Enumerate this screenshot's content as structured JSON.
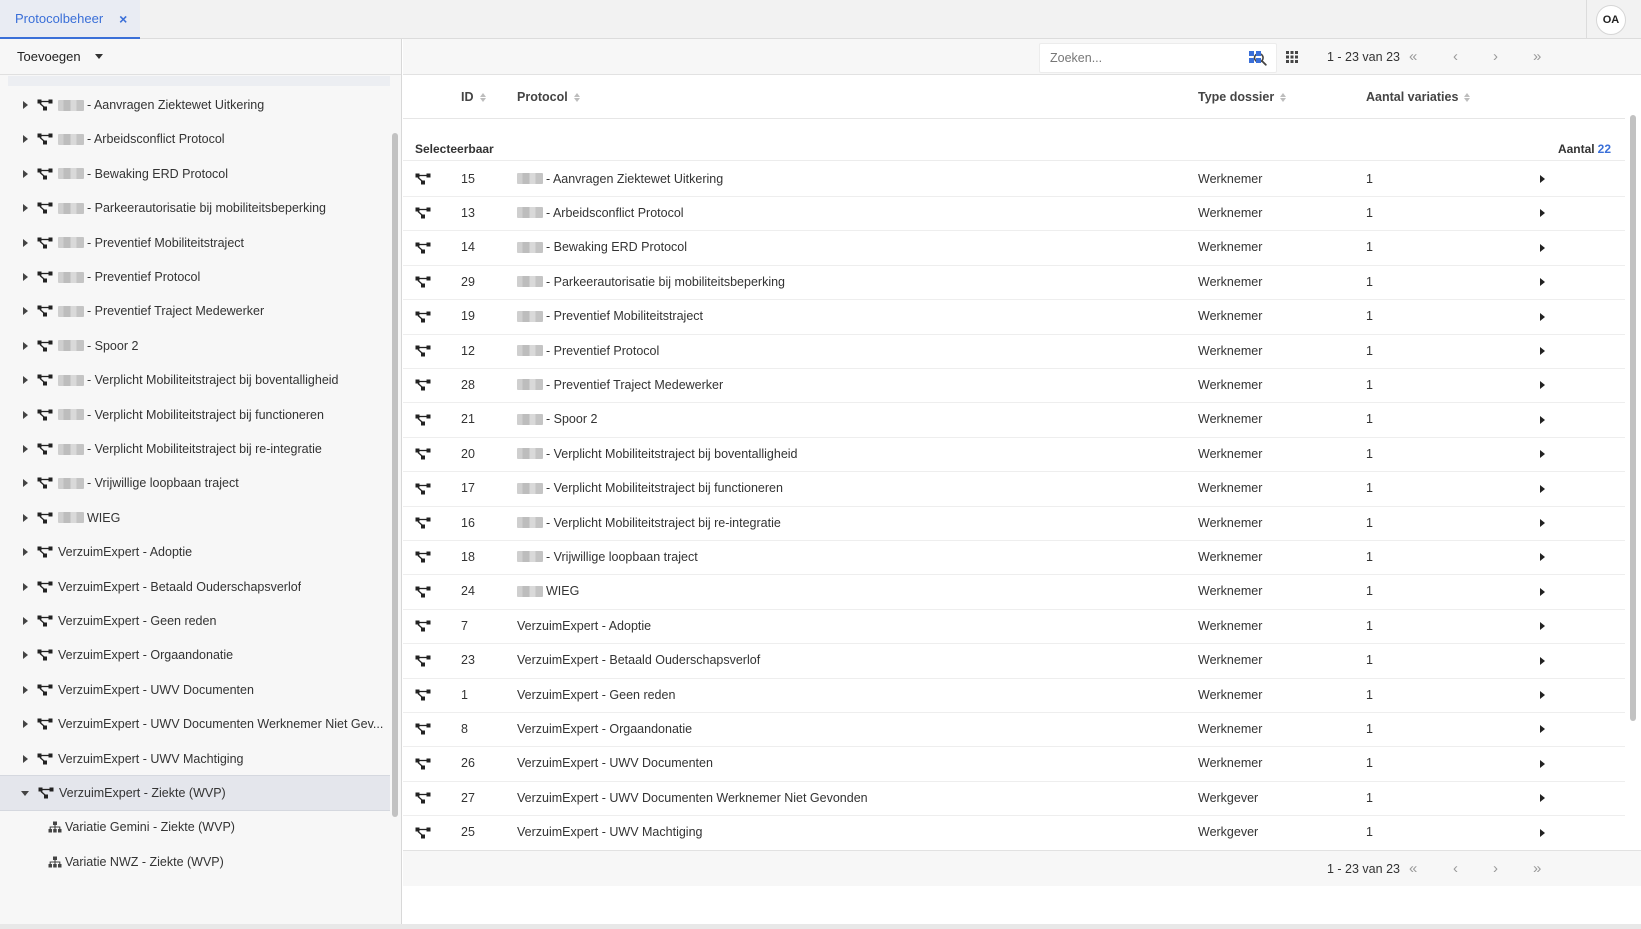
{
  "tabbar": {
    "tab_label": "Protocolbeheer",
    "close_glyph": "×",
    "avatar_initials": "OA"
  },
  "colors": {
    "accent": "#3a6fd8",
    "panel_bg": "#f7f7f7",
    "selected_row": "#e4e6ec"
  },
  "left": {
    "add_label": "Toevoegen",
    "tree": [
      {
        "label": "- Aanvragen Ziektewet Uitkering",
        "masked": true,
        "expanded": false
      },
      {
        "label": "- Arbeidsconflict Protocol",
        "masked": true,
        "expanded": false
      },
      {
        "label": "- Bewaking ERD Protocol",
        "masked": true,
        "expanded": false
      },
      {
        "label": "- Parkeerautorisatie bij mobiliteitsbeperking",
        "masked": true,
        "expanded": false
      },
      {
        "label": "- Preventief Mobiliteitstraject",
        "masked": true,
        "expanded": false
      },
      {
        "label": "- Preventief Protocol",
        "masked": true,
        "expanded": false
      },
      {
        "label": "- Preventief Traject Medewerker",
        "masked": true,
        "expanded": false
      },
      {
        "label": "- Spoor 2",
        "masked": true,
        "expanded": false
      },
      {
        "label": "- Verplicht Mobiliteitstraject bij boventalligheid",
        "masked": true,
        "expanded": false
      },
      {
        "label": "- Verplicht Mobiliteitstraject bij functioneren",
        "masked": true,
        "expanded": false
      },
      {
        "label": "- Verplicht Mobiliteitstraject bij re-integratie",
        "masked": true,
        "expanded": false
      },
      {
        "label": "- Vrijwillige loopbaan traject",
        "masked": true,
        "expanded": false
      },
      {
        "label": "WIEG",
        "masked": true,
        "expanded": false
      },
      {
        "label": "VerzuimExpert - Adoptie",
        "masked": false,
        "expanded": false
      },
      {
        "label": "VerzuimExpert - Betaald Ouderschapsverlof",
        "masked": false,
        "expanded": false
      },
      {
        "label": "VerzuimExpert - Geen reden",
        "masked": false,
        "expanded": false
      },
      {
        "label": "VerzuimExpert - Orgaandonatie",
        "masked": false,
        "expanded": false
      },
      {
        "label": "VerzuimExpert - UWV Documenten",
        "masked": false,
        "expanded": false
      },
      {
        "label": "VerzuimExpert - UWV Documenten Werknemer Niet Gev...",
        "masked": false,
        "expanded": false
      },
      {
        "label": "VerzuimExpert - UWV Machtiging",
        "masked": false,
        "expanded": false
      },
      {
        "label": "VerzuimExpert - Ziekte (WVP)",
        "masked": false,
        "expanded": true,
        "selected": true
      },
      {
        "label": "Variatie Gemini - Ziekte (WVP)",
        "variation": true
      },
      {
        "label": "Variatie NWZ - Ziekte (WVP)",
        "variation": true
      }
    ]
  },
  "search": {
    "placeholder": "Zoeken...",
    "value": ""
  },
  "pager": {
    "range_text": "1 - 23 van 23",
    "first": "«",
    "prev": "‹",
    "next": "›",
    "last": "»"
  },
  "table": {
    "headers": {
      "id": "ID",
      "protocol": "Protocol",
      "type": "Type dossier",
      "variations": "Aantal variaties"
    },
    "group_label": "Selecteerbaar",
    "count_label": "Aantal",
    "count_value": "22",
    "rows": [
      {
        "id": "15",
        "protocol": "- Aanvragen Ziektewet Uitkering",
        "masked": true,
        "type": "Werknemer",
        "variations": "1"
      },
      {
        "id": "13",
        "protocol": "- Arbeidsconflict Protocol",
        "masked": true,
        "type": "Werknemer",
        "variations": "1"
      },
      {
        "id": "14",
        "protocol": "- Bewaking ERD Protocol",
        "masked": true,
        "type": "Werknemer",
        "variations": "1"
      },
      {
        "id": "29",
        "protocol": "- Parkeerautorisatie bij mobiliteitsbeperking",
        "masked": true,
        "type": "Werknemer",
        "variations": "1"
      },
      {
        "id": "19",
        "protocol": "- Preventief Mobiliteitstraject",
        "masked": true,
        "type": "Werknemer",
        "variations": "1"
      },
      {
        "id": "12",
        "protocol": "- Preventief Protocol",
        "masked": true,
        "type": "Werknemer",
        "variations": "1"
      },
      {
        "id": "28",
        "protocol": "- Preventief Traject Medewerker",
        "masked": true,
        "type": "Werknemer",
        "variations": "1"
      },
      {
        "id": "21",
        "protocol": "- Spoor 2",
        "masked": true,
        "type": "Werknemer",
        "variations": "1"
      },
      {
        "id": "20",
        "protocol": "- Verplicht Mobiliteitstraject bij boventalligheid",
        "masked": true,
        "type": "Werknemer",
        "variations": "1"
      },
      {
        "id": "17",
        "protocol": "- Verplicht Mobiliteitstraject bij functioneren",
        "masked": true,
        "type": "Werknemer",
        "variations": "1"
      },
      {
        "id": "16",
        "protocol": "- Verplicht Mobiliteitstraject bij re-integratie",
        "masked": true,
        "type": "Werknemer",
        "variations": "1"
      },
      {
        "id": "18",
        "protocol": "- Vrijwillige loopbaan traject",
        "masked": true,
        "type": "Werknemer",
        "variations": "1"
      },
      {
        "id": "24",
        "protocol": "WIEG",
        "masked": true,
        "type": "Werknemer",
        "variations": "1"
      },
      {
        "id": "7",
        "protocol": "VerzuimExpert - Adoptie",
        "masked": false,
        "type": "Werknemer",
        "variations": "1"
      },
      {
        "id": "23",
        "protocol": "VerzuimExpert - Betaald Ouderschapsverlof",
        "masked": false,
        "type": "Werknemer",
        "variations": "1"
      },
      {
        "id": "1",
        "protocol": "VerzuimExpert - Geen reden",
        "masked": false,
        "type": "Werknemer",
        "variations": "1"
      },
      {
        "id": "8",
        "protocol": "VerzuimExpert - Orgaandonatie",
        "masked": false,
        "type": "Werknemer",
        "variations": "1"
      },
      {
        "id": "26",
        "protocol": "VerzuimExpert - UWV Documenten",
        "masked": false,
        "type": "Werknemer",
        "variations": "1"
      },
      {
        "id": "27",
        "protocol": "VerzuimExpert - UWV Documenten Werknemer Niet Gevonden",
        "masked": false,
        "type": "Werkgever",
        "variations": "1"
      },
      {
        "id": "25",
        "protocol": "VerzuimExpert - UWV Machtiging",
        "masked": false,
        "type": "Werkgever",
        "variations": "1"
      }
    ]
  }
}
